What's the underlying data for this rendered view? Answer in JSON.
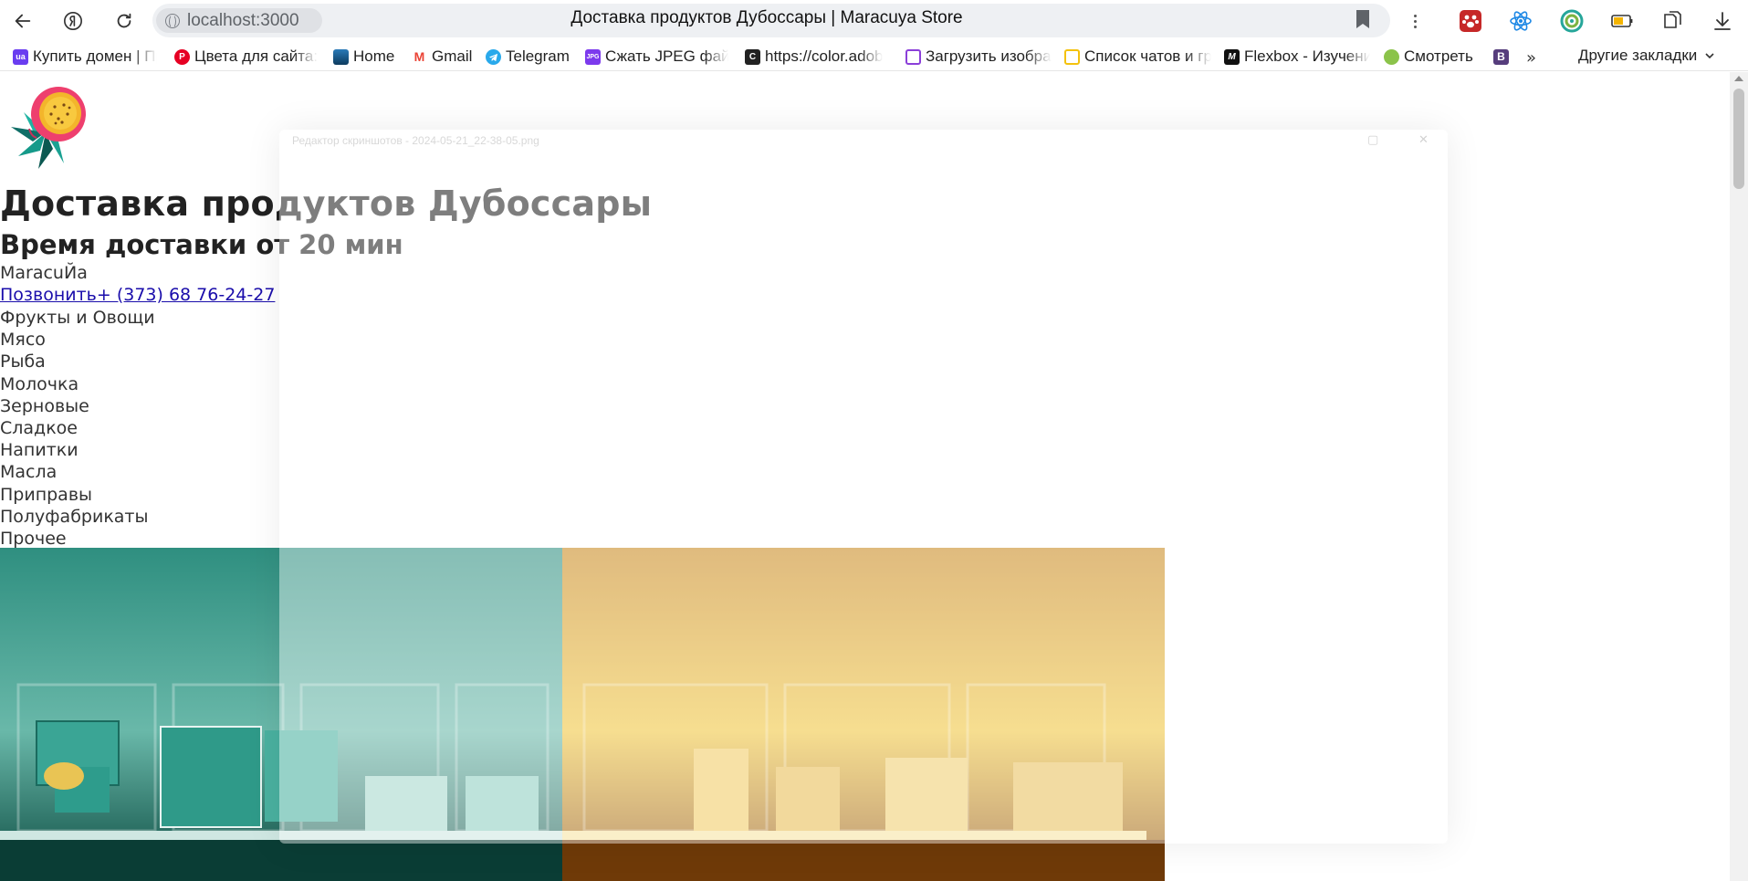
{
  "browser": {
    "url": "localhost:3000",
    "tab_title": "Доставка продуктов Дубоссары | Maracuya Store",
    "bookmarks": [
      {
        "label": "Купить домен | Пр",
        "icon": "ua-icon",
        "color": "#6a3df0",
        "glyph": "ua"
      },
      {
        "label": "Цвета для сайта:",
        "icon": "pinterest-icon",
        "color": "#e60023",
        "glyph": "P"
      },
      {
        "label": "Home",
        "icon": "home-thumb-icon",
        "color": "#1c5f8f",
        "glyph": ""
      },
      {
        "label": "Gmail",
        "icon": "gmail-icon",
        "color": "#ea4335",
        "glyph": "M"
      },
      {
        "label": "Telegram",
        "icon": "telegram-icon",
        "color": "#29a9eb",
        "glyph": ""
      },
      {
        "label": "Сжать JPEG файл",
        "icon": "jpg-icon",
        "color": "#7c3aed",
        "glyph": "JPG"
      },
      {
        "label": "https://color.adob",
        "icon": "adobe-color-icon",
        "color": "#222222",
        "glyph": "C"
      },
      {
        "label": "Загрузить изобра",
        "icon": "upload-image-icon",
        "color": "#8b3fd9",
        "glyph": ""
      },
      {
        "label": "Список чатов и гр",
        "icon": "chat-list-icon",
        "color": "#f4c20d",
        "glyph": ""
      },
      {
        "label": "Flexbox - Изучени",
        "icon": "flexbox-icon",
        "color": "#111111",
        "glyph": "M"
      },
      {
        "label": "Смотреть",
        "icon": "watch-icon",
        "color": "#8bc34a",
        "glyph": ""
      },
      {
        "label": "",
        "icon": "bootstrap-icon",
        "color": "#563d7c",
        "glyph": "B"
      }
    ],
    "more_bookmarks": "»",
    "other_bookmarks": "Другие закладки"
  },
  "page": {
    "title": "Доставка продуктов Дубоссары",
    "subtitle": "Время доставки от 20 мин",
    "brand": "MaracuЙa",
    "call_link": "Позвонить+ (373) 68 76-24-27",
    "categories": [
      "Фрукты и Овощи",
      "Мясо",
      "Рыба",
      "Молочка",
      "Зерновые",
      "Сладкое",
      "Напитки",
      "Масла",
      "Приправы",
      "Полуфабрикаты",
      "Прочее"
    ],
    "hero_left_color": "#1f8f7f",
    "hero_right_color": "#e0a51f"
  },
  "ghost_window": {
    "title": "Редактор скриншотов - 2024-05-21_22-38-05.png"
  }
}
